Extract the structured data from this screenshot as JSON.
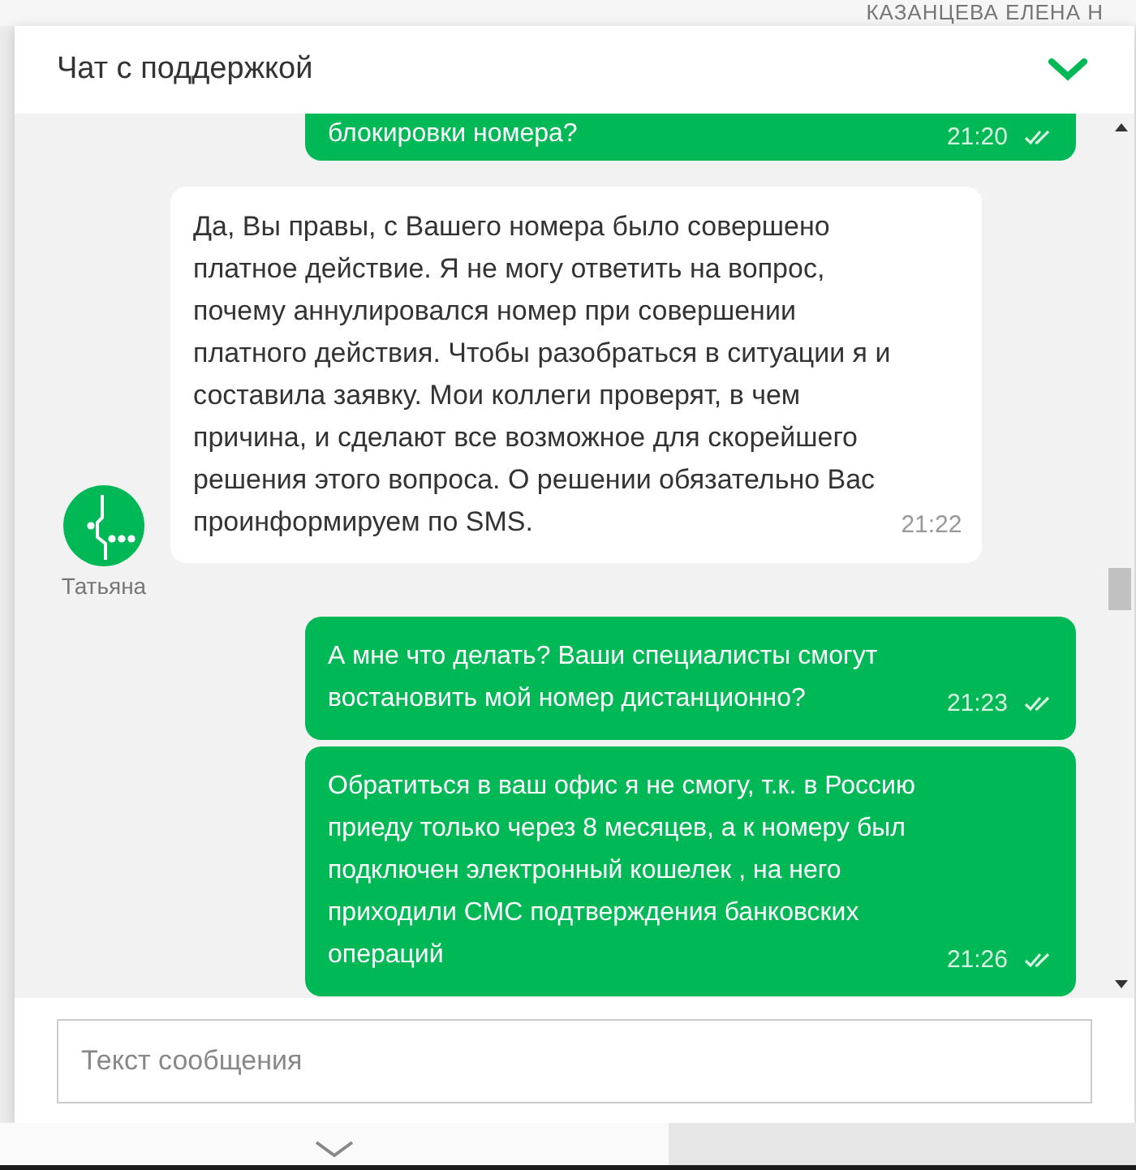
{
  "background": {
    "heading": "КАЗАНЦЕВА ЕЛЕНА Н"
  },
  "chat": {
    "title": "Чат с поддержкой",
    "messages": [
      {
        "kind": "outgoing",
        "cut": true,
        "text": "блокировки номера?",
        "time": "21:20",
        "read": true
      },
      {
        "kind": "incoming",
        "author": "Татьяна",
        "text": "Да, Вы правы, с Вашего номера было совершено\nплатное действие. Я не могу ответить на вопрос,\nпочему аннулировался номер при совершении\nплатного действия. Чтобы разобраться в ситуации я и\nсоставила заявку. Мои коллеги проверят, в чем\nпричина, и сделают все возможное для скорейшего\nрешения этого вопроса. О решении обязательно Вас\nпроинформируем по SMS.",
        "time": "21:22"
      },
      {
        "kind": "outgoing",
        "cut": false,
        "text": "А мне что делать? Ваши специалисты смогут\nвостановить мой номер дистанционно?",
        "time": "21:23",
        "read": true
      },
      {
        "kind": "outgoing",
        "cut": false,
        "text": "Обратиться в ваш офис я не смогу, т.к. в Россию\nприеду только через 8 месяцев, а к номеру был\nподключен электронный кошелек , на него\nприходили СМС подтверждения банковских\nопераций",
        "time": "21:26",
        "read": true
      }
    ],
    "input": {
      "placeholder": "Текст сообщения"
    }
  }
}
